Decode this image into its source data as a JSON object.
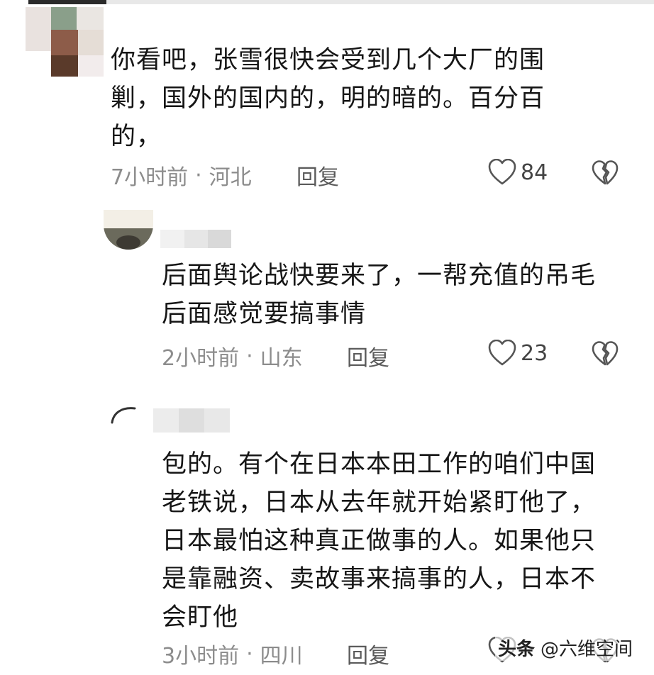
{
  "comments": [
    {
      "text": "你看吧，张雪很快会受到几个大厂的围\n剿，国外的国内的，明的暗的。百分百\n的，",
      "time": "7小时前",
      "location": "河北",
      "reply_label": "回复",
      "likes": "84"
    },
    {
      "text": "后面舆论战快要来了，一帮充值的吊毛\n后面感觉要搞事情",
      "time": "2小时前",
      "location": "山东",
      "reply_label": "回复",
      "likes": "23"
    },
    {
      "text": "包的。有个在日本本田工作的咱们中国\n老铁说，日本从去年就开始紧盯他了，\n日本最怕这种真正做事的人。如果他只\n是靠融资、卖故事来搞事的人，日本不\n会盯他",
      "time": "3小时前",
      "location": "四川",
      "reply_label": "回复",
      "likes": ""
    }
  ],
  "separator": "·",
  "watermark": {
    "brand": "头条",
    "handle": "@六维空间"
  },
  "icons": {
    "like": "heart-outline-icon",
    "dislike": "broken-heart-icon"
  },
  "colors": {
    "meta_text": "#8c8c8c",
    "body_text": "#161616",
    "icon_stroke": "#555555"
  }
}
